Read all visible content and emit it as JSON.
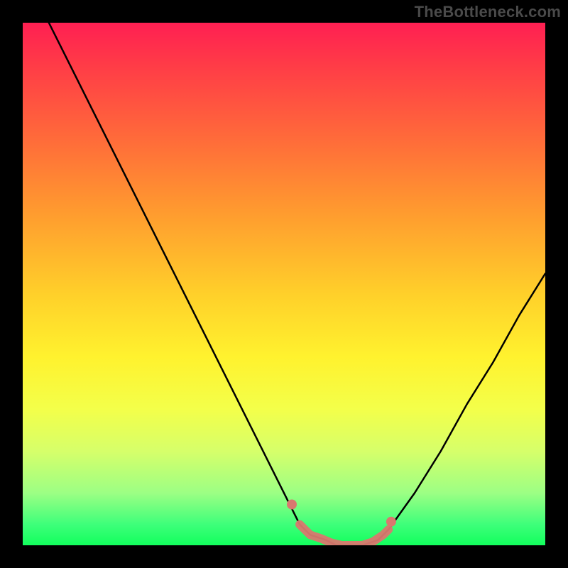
{
  "watermark": "TheBottleneck.com",
  "colors": {
    "background": "#000000",
    "gradient_top": "#ff1f52",
    "gradient_bottom": "#12ff5d",
    "curve_line": "#000000",
    "marker": "#d9786f"
  },
  "chart_data": {
    "type": "line",
    "title": "",
    "xlabel": "",
    "ylabel": "",
    "xlim": [
      0,
      100
    ],
    "ylim": [
      0,
      100
    ],
    "x": [
      5,
      10,
      15,
      20,
      25,
      30,
      35,
      40,
      45,
      50,
      53,
      55,
      58,
      60,
      62,
      65,
      68,
      70,
      75,
      80,
      85,
      90,
      95,
      100
    ],
    "values": [
      100,
      90,
      80,
      70,
      60,
      50,
      40,
      30,
      20,
      10,
      4,
      2,
      1,
      0,
      0,
      0,
      1,
      3,
      10,
      18,
      27,
      35,
      44,
      52
    ],
    "flat_region_x": [
      55,
      68
    ],
    "markers_x": [
      53,
      55,
      57,
      59,
      61,
      63,
      65,
      67,
      69,
      70
    ]
  }
}
